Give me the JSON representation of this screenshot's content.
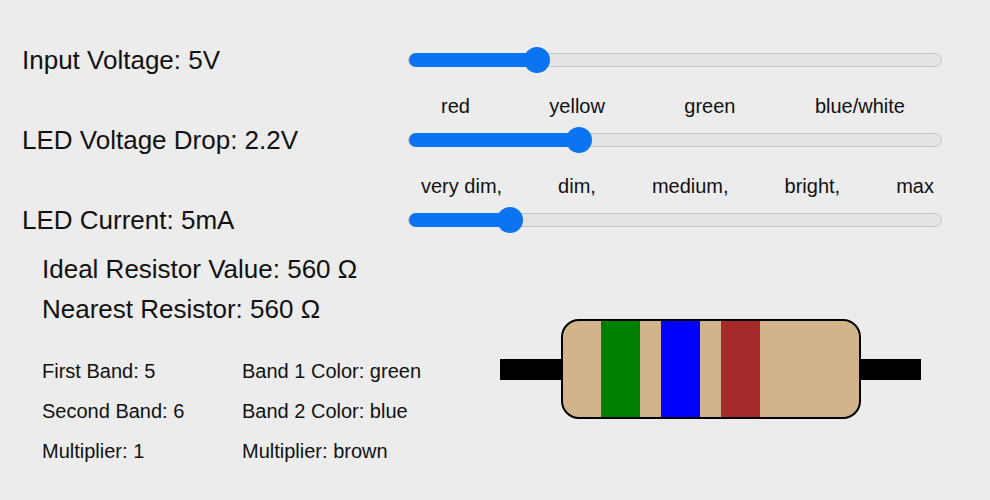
{
  "sliders": [
    {
      "label": "Input Voltage: 5V",
      "level": 0.24,
      "ticks": []
    },
    {
      "label": "LED Voltage Drop: 2.2V",
      "level": 0.32,
      "ticks": [
        "red",
        "yellow",
        "green",
        "blue/white"
      ]
    },
    {
      "label": "LED Current: 5mA",
      "level": 0.19,
      "ticks": [
        "very dim,",
        "dim,",
        "medium,",
        "bright,",
        "max"
      ]
    }
  ],
  "results": {
    "ideal": "Ideal Resistor Value: 560 Ω",
    "nearest": "Nearest Resistor: 560 Ω"
  },
  "bands": [
    {
      "value": "First Band: 5",
      "color_label": "Band 1 Color: green",
      "color": "#008000"
    },
    {
      "value": "Second Band: 6",
      "color_label": "Band 2 Color: blue",
      "color": "#0000ff"
    },
    {
      "value": "Multiplier: 1",
      "color_label": "Multiplier: brown",
      "color": "#a52a2a"
    }
  ]
}
